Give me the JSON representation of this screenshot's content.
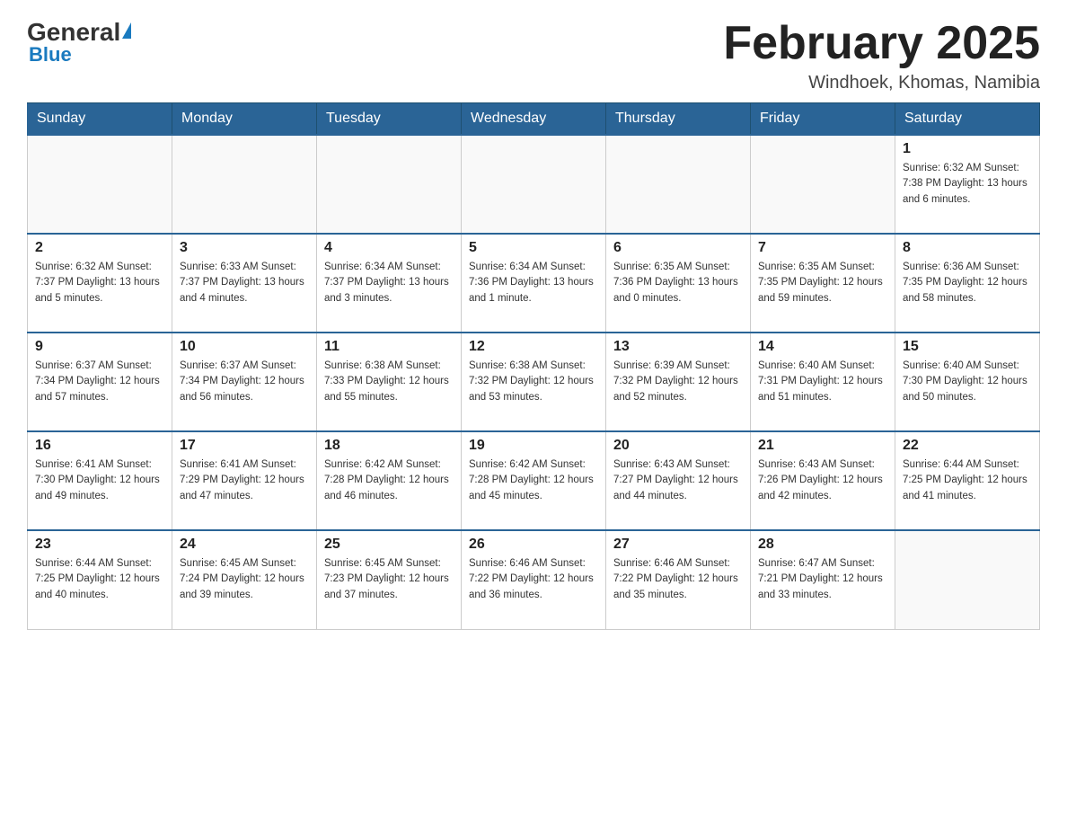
{
  "header": {
    "logo_general": "General",
    "logo_blue": "Blue",
    "month_title": "February 2025",
    "location": "Windhoek, Khomas, Namibia"
  },
  "days_of_week": [
    "Sunday",
    "Monday",
    "Tuesday",
    "Wednesday",
    "Thursday",
    "Friday",
    "Saturday"
  ],
  "weeks": [
    [
      {
        "day": "",
        "info": ""
      },
      {
        "day": "",
        "info": ""
      },
      {
        "day": "",
        "info": ""
      },
      {
        "day": "",
        "info": ""
      },
      {
        "day": "",
        "info": ""
      },
      {
        "day": "",
        "info": ""
      },
      {
        "day": "1",
        "info": "Sunrise: 6:32 AM\nSunset: 7:38 PM\nDaylight: 13 hours and 6 minutes."
      }
    ],
    [
      {
        "day": "2",
        "info": "Sunrise: 6:32 AM\nSunset: 7:37 PM\nDaylight: 13 hours and 5 minutes."
      },
      {
        "day": "3",
        "info": "Sunrise: 6:33 AM\nSunset: 7:37 PM\nDaylight: 13 hours and 4 minutes."
      },
      {
        "day": "4",
        "info": "Sunrise: 6:34 AM\nSunset: 7:37 PM\nDaylight: 13 hours and 3 minutes."
      },
      {
        "day": "5",
        "info": "Sunrise: 6:34 AM\nSunset: 7:36 PM\nDaylight: 13 hours and 1 minute."
      },
      {
        "day": "6",
        "info": "Sunrise: 6:35 AM\nSunset: 7:36 PM\nDaylight: 13 hours and 0 minutes."
      },
      {
        "day": "7",
        "info": "Sunrise: 6:35 AM\nSunset: 7:35 PM\nDaylight: 12 hours and 59 minutes."
      },
      {
        "day": "8",
        "info": "Sunrise: 6:36 AM\nSunset: 7:35 PM\nDaylight: 12 hours and 58 minutes."
      }
    ],
    [
      {
        "day": "9",
        "info": "Sunrise: 6:37 AM\nSunset: 7:34 PM\nDaylight: 12 hours and 57 minutes."
      },
      {
        "day": "10",
        "info": "Sunrise: 6:37 AM\nSunset: 7:34 PM\nDaylight: 12 hours and 56 minutes."
      },
      {
        "day": "11",
        "info": "Sunrise: 6:38 AM\nSunset: 7:33 PM\nDaylight: 12 hours and 55 minutes."
      },
      {
        "day": "12",
        "info": "Sunrise: 6:38 AM\nSunset: 7:32 PM\nDaylight: 12 hours and 53 minutes."
      },
      {
        "day": "13",
        "info": "Sunrise: 6:39 AM\nSunset: 7:32 PM\nDaylight: 12 hours and 52 minutes."
      },
      {
        "day": "14",
        "info": "Sunrise: 6:40 AM\nSunset: 7:31 PM\nDaylight: 12 hours and 51 minutes."
      },
      {
        "day": "15",
        "info": "Sunrise: 6:40 AM\nSunset: 7:30 PM\nDaylight: 12 hours and 50 minutes."
      }
    ],
    [
      {
        "day": "16",
        "info": "Sunrise: 6:41 AM\nSunset: 7:30 PM\nDaylight: 12 hours and 49 minutes."
      },
      {
        "day": "17",
        "info": "Sunrise: 6:41 AM\nSunset: 7:29 PM\nDaylight: 12 hours and 47 minutes."
      },
      {
        "day": "18",
        "info": "Sunrise: 6:42 AM\nSunset: 7:28 PM\nDaylight: 12 hours and 46 minutes."
      },
      {
        "day": "19",
        "info": "Sunrise: 6:42 AM\nSunset: 7:28 PM\nDaylight: 12 hours and 45 minutes."
      },
      {
        "day": "20",
        "info": "Sunrise: 6:43 AM\nSunset: 7:27 PM\nDaylight: 12 hours and 44 minutes."
      },
      {
        "day": "21",
        "info": "Sunrise: 6:43 AM\nSunset: 7:26 PM\nDaylight: 12 hours and 42 minutes."
      },
      {
        "day": "22",
        "info": "Sunrise: 6:44 AM\nSunset: 7:25 PM\nDaylight: 12 hours and 41 minutes."
      }
    ],
    [
      {
        "day": "23",
        "info": "Sunrise: 6:44 AM\nSunset: 7:25 PM\nDaylight: 12 hours and 40 minutes."
      },
      {
        "day": "24",
        "info": "Sunrise: 6:45 AM\nSunset: 7:24 PM\nDaylight: 12 hours and 39 minutes."
      },
      {
        "day": "25",
        "info": "Sunrise: 6:45 AM\nSunset: 7:23 PM\nDaylight: 12 hours and 37 minutes."
      },
      {
        "day": "26",
        "info": "Sunrise: 6:46 AM\nSunset: 7:22 PM\nDaylight: 12 hours and 36 minutes."
      },
      {
        "day": "27",
        "info": "Sunrise: 6:46 AM\nSunset: 7:22 PM\nDaylight: 12 hours and 35 minutes."
      },
      {
        "day": "28",
        "info": "Sunrise: 6:47 AM\nSunset: 7:21 PM\nDaylight: 12 hours and 33 minutes."
      },
      {
        "day": "",
        "info": ""
      }
    ]
  ]
}
